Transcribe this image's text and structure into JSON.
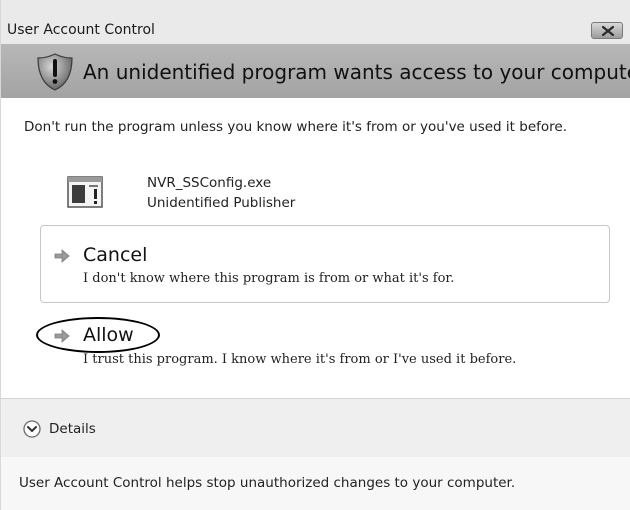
{
  "window": {
    "title": "User Account Control",
    "close_icon": "close-icon"
  },
  "header": {
    "icon": "shield-exclamation-icon",
    "text": "An unidentified program wants access to your computer"
  },
  "message": "Don't run the program unless you know where it's from or you've used it before.",
  "program": {
    "icon": "executable-file-icon",
    "name": "NVR_SSConfig.exe",
    "publisher": "Unidentified Publisher"
  },
  "options": [
    {
      "icon": "arrow-right-icon",
      "title": "Cancel",
      "description": "I don't know where this program is from or what it's for."
    },
    {
      "icon": "arrow-right-icon",
      "title": "Allow",
      "description": "I trust this program. I know where it's from or I've used it before."
    }
  ],
  "details": {
    "icon": "chevron-down-circle-icon",
    "label": "Details"
  },
  "footer": {
    "text": "User Account Control helps stop unauthorized changes to your computer."
  }
}
